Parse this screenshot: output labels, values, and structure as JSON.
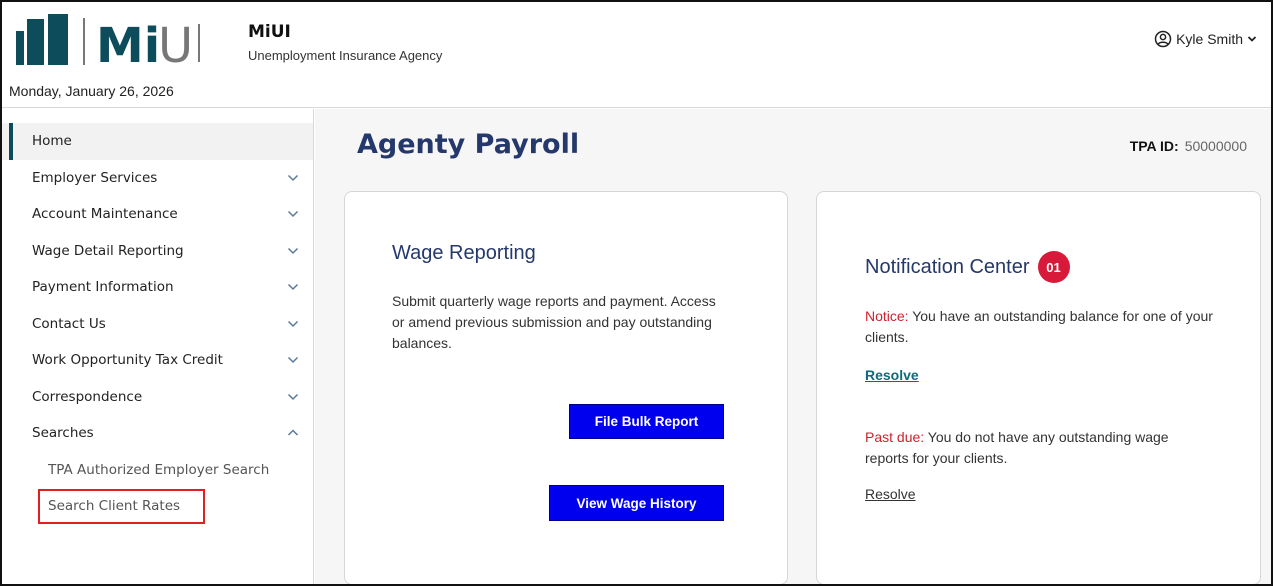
{
  "header": {
    "brand_name": "MiUI",
    "brand_sub": "Unemployment Insurance Agency",
    "logo_text": "MiUI",
    "date": "Monday, January 26, 2026",
    "user_name": "Kyle Smith"
  },
  "sidebar": {
    "items": [
      {
        "label": "Home",
        "active": true,
        "chevron": "none"
      },
      {
        "label": "Employer Services",
        "chevron": "down"
      },
      {
        "label": "Account Maintenance",
        "chevron": "down"
      },
      {
        "label": "Wage Detail Reporting",
        "chevron": "down"
      },
      {
        "label": "Payment Information",
        "chevron": "down"
      },
      {
        "label": "Contact Us",
        "chevron": "down"
      },
      {
        "label": "Work Opportunity Tax Credit",
        "chevron": "down"
      },
      {
        "label": "Correspondence",
        "chevron": "down"
      },
      {
        "label": "Searches",
        "chevron": "up"
      }
    ],
    "sub_items": [
      {
        "label": "TPA Authorized Employer Search"
      },
      {
        "label": "Search Client Rates"
      }
    ]
  },
  "main": {
    "title": "Agenty Payroll",
    "tpa_label": "TPA ID:",
    "tpa_value": "50000000",
    "wage_card": {
      "title": "Wage Reporting",
      "description": "Submit quarterly wage reports and payment. Access or amend previous submission and pay outstanding balances.",
      "bulk_button": "File Bulk Report",
      "history_button": "View Wage History"
    },
    "notification_card": {
      "title": "Notification Center",
      "badge": "01",
      "notice_label": "Notice:",
      "notice_text": "You have an outstanding balance for one of your clients.",
      "notice_link": "Resolve",
      "pastdue_label": "Past due:",
      "pastdue_text": "You do not have any outstanding wage reports for your clients.",
      "pastdue_link": "Resolve"
    }
  },
  "colors": {
    "brand_teal": "#0d4c5a",
    "title_navy": "#24386b",
    "button_blue": "#0000ee",
    "alert_red": "#d21f2c",
    "badge_red": "#d7193a"
  }
}
